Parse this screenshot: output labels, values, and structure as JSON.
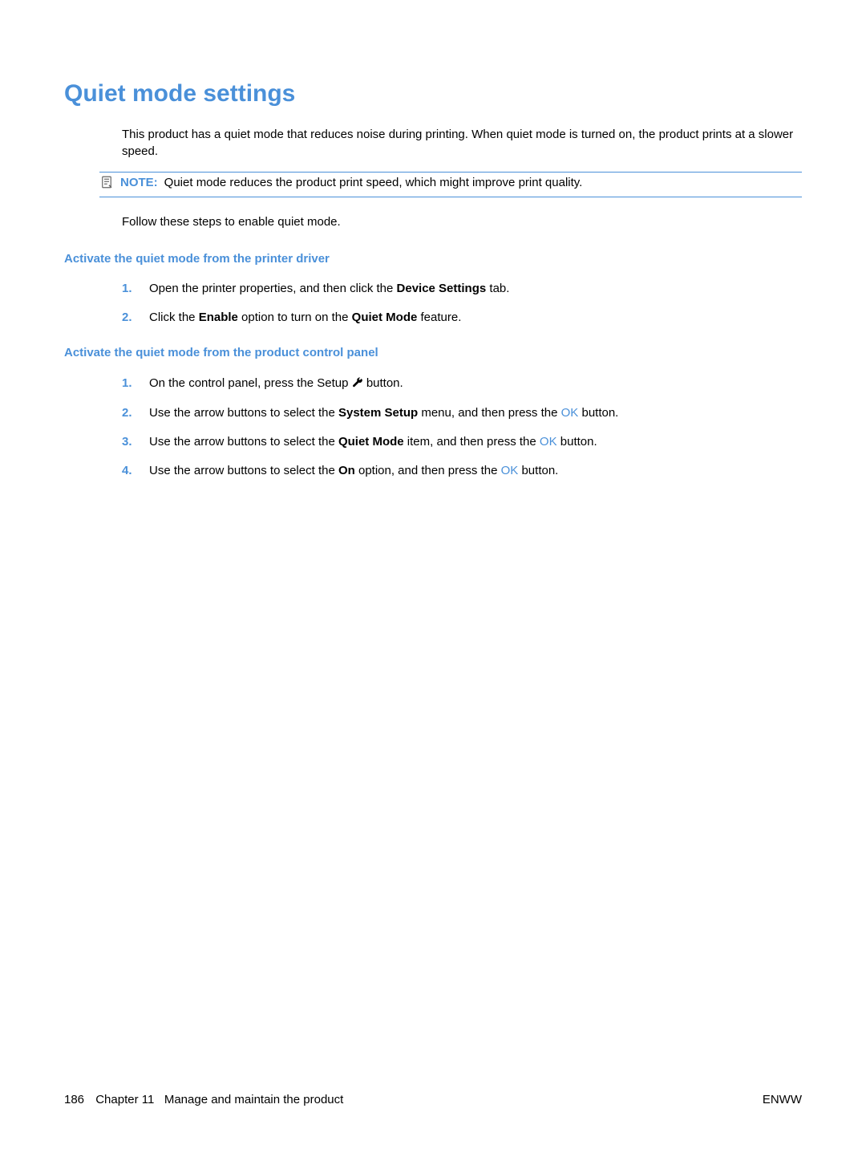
{
  "title": "Quiet mode settings",
  "intro": "This product has a quiet mode that reduces noise during printing. When quiet mode is turned on, the product prints at a slower speed.",
  "note": {
    "label": "NOTE:",
    "text": "Quiet mode reduces the product print speed, which might improve print quality."
  },
  "follow": "Follow these steps to enable quiet mode.",
  "section1": {
    "heading": "Activate the quiet mode from the printer driver",
    "steps": {
      "s1": {
        "num": "1.",
        "pre": "Open the printer properties, and then click the ",
        "bold": "Device Settings",
        "post": " tab."
      },
      "s2": {
        "num": "2.",
        "pre": "Click the ",
        "bold1": "Enable",
        "mid": " option to turn on the ",
        "bold2": "Quiet Mode",
        "post": " feature."
      }
    }
  },
  "section2": {
    "heading": "Activate the quiet mode from the product control panel",
    "steps": {
      "s1": {
        "num": "1.",
        "pre": "On the control panel, press the Setup ",
        "post": " button."
      },
      "s2": {
        "num": "2.",
        "pre": "Use the arrow buttons to select the ",
        "bold": "System Setup",
        "mid": " menu, and then press the ",
        "ok": "OK",
        "post": " button."
      },
      "s3": {
        "num": "3.",
        "pre": "Use the arrow buttons to select the ",
        "bold": "Quiet Mode",
        "mid": " item, and then press the ",
        "ok": "OK",
        "post": " button."
      },
      "s4": {
        "num": "4.",
        "pre": "Use the arrow buttons to select the ",
        "bold": "On",
        "mid": " option, and then press the ",
        "ok": "OK",
        "post": " button."
      }
    }
  },
  "footer": {
    "page": "186",
    "chapter_label": "Chapter 11",
    "chapter_title": "Manage and maintain the product",
    "right": "ENWW"
  }
}
